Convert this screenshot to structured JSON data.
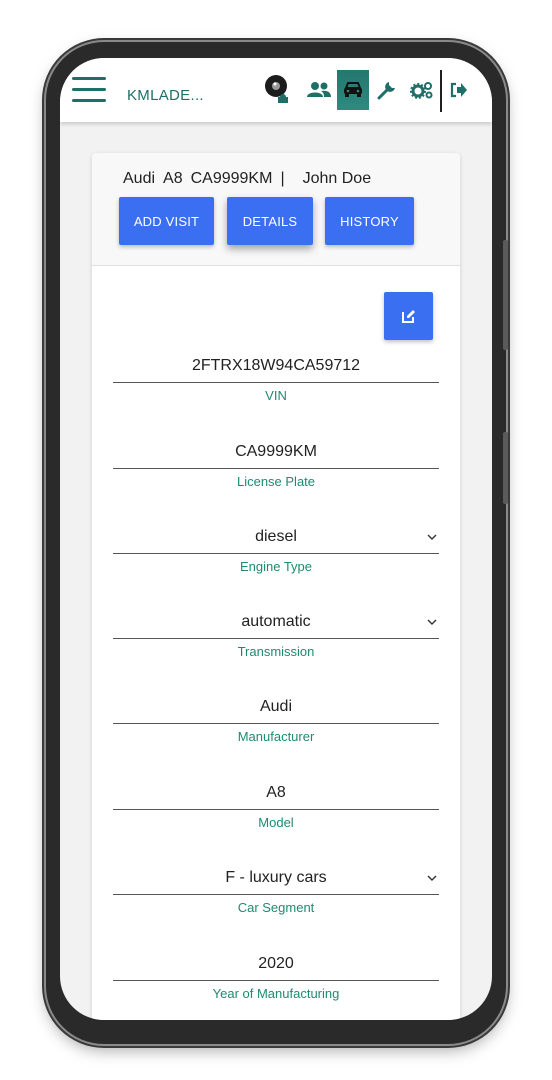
{
  "app": {
    "title": "KMLADE..."
  },
  "nav": {
    "icons": [
      "avatar-icon",
      "users-icon",
      "car-icon",
      "wrench-icon",
      "gears-icon",
      "logout-icon"
    ],
    "active": "car-icon"
  },
  "vehicle": {
    "make": "Audi",
    "model": "A8",
    "plate": "CA9999KM",
    "separator": "|",
    "owner": "John Doe"
  },
  "buttons": {
    "add_visit": "ADD VISIT",
    "details": "DETAILS",
    "history": "HISTORY"
  },
  "fields": {
    "vin": {
      "value": "2FTRX18W94CA59712",
      "label": "VIN"
    },
    "plate": {
      "value": "CA9999KM",
      "label": "License Plate"
    },
    "engine": {
      "value": "diesel",
      "label": "Engine Type"
    },
    "transmission": {
      "value": "automatic",
      "label": "Transmission"
    },
    "manufacturer": {
      "value": "Audi",
      "label": "Manufacturer"
    },
    "model": {
      "value": "A8",
      "label": "Model"
    },
    "segment": {
      "value": "F - luxury cars",
      "label": "Car Segment"
    },
    "year": {
      "value": "2020",
      "label": "Year of Manufacturing"
    }
  },
  "colors": {
    "accent": "#3b6ff2",
    "brand": "#1f6f68",
    "label": "#1f8a70"
  }
}
